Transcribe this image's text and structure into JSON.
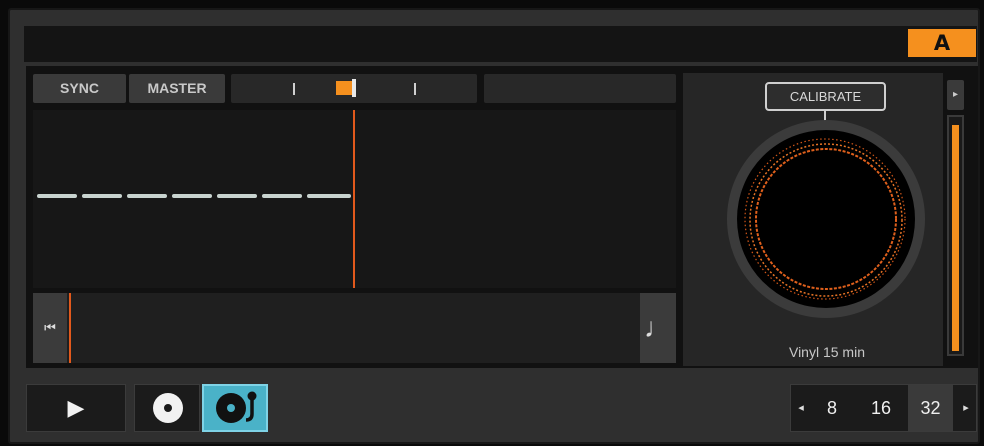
{
  "deck": {
    "letter": "A"
  },
  "controls": {
    "sync_label": "SYNC",
    "master_label": "MASTER"
  },
  "timecode": {
    "calibrate_label": "CALIBRATE",
    "vinyl_label": "Vinyl 15 min",
    "level": 0.98
  },
  "icons": {
    "jump": "skip-to-start-icon",
    "note": "music-note-icon",
    "play": "play-icon",
    "cd": "cd-icon",
    "vinyl": "turntable-icon",
    "right_arrow": "arrow-right-icon"
  },
  "transport": {
    "play_symbol": "▶",
    "jump_symbol": "⏮",
    "note_symbol": "♩",
    "arrow_left": "◂",
    "arrow_right": "▸"
  },
  "loop": {
    "values": [
      "8",
      "16",
      "32"
    ],
    "selected": "32"
  },
  "colors": {
    "accent": "#f5901e",
    "playhead": "#e2591c",
    "vinyl_active": "#4ab2c8"
  }
}
